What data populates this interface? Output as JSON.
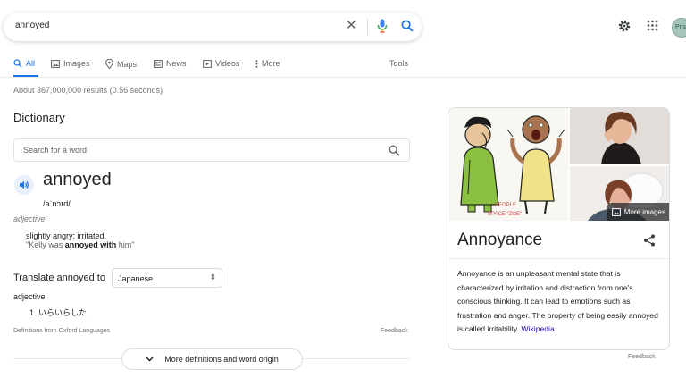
{
  "search": {
    "query": "annoyed"
  },
  "header": {
    "avatar_text": "Pris"
  },
  "tabs": [
    {
      "label": "All",
      "icon": "search-icon"
    },
    {
      "label": "Images",
      "icon": "image-icon"
    },
    {
      "label": "Maps",
      "icon": "map-pin-icon"
    },
    {
      "label": "News",
      "icon": "news-icon"
    },
    {
      "label": "Videos",
      "icon": "video-icon"
    },
    {
      "label": "More",
      "icon": "more-vert-icon"
    }
  ],
  "tools_label": "Tools",
  "stats": "About 367,000,000 results (0.56 seconds)",
  "dictionary": {
    "title": "Dictionary",
    "search_placeholder": "Search for a word",
    "word": "annoyed",
    "phonetic": "/əˈnɔɪd/",
    "part_of_speech": "adjective",
    "definition": "slightly angry; irritated.",
    "example_pre": "\"Kelly was ",
    "example_bold": "annoyed with",
    "example_post": " him\"",
    "translate_label": "Translate annoyed to",
    "translate_language": "Japanese",
    "translation_pos": "adjective",
    "translation": "1. いらいらした",
    "source": "Definitions from Oxford Languages",
    "feedback": "Feedback",
    "more_button": "More definitions and word origin"
  },
  "knowledge_panel": {
    "title": "Annoyance",
    "more_images": "More images",
    "cartoon_caption_1": "PEOPLE",
    "cartoon_caption_2": "SPACE \"ZOE\"",
    "description": "Annoyance is an unpleasant mental state that is characterized by irritation and distraction from one's conscious thinking. It can lead to emotions such as frustration and anger. The property of being easily annoyed is called irritability.",
    "link": "Wikipedia",
    "feedback": "Feedback"
  },
  "colors": {
    "accent": "#1a73e8",
    "link": "#1a0dab",
    "text": "#202124",
    "muted": "#70757a"
  }
}
